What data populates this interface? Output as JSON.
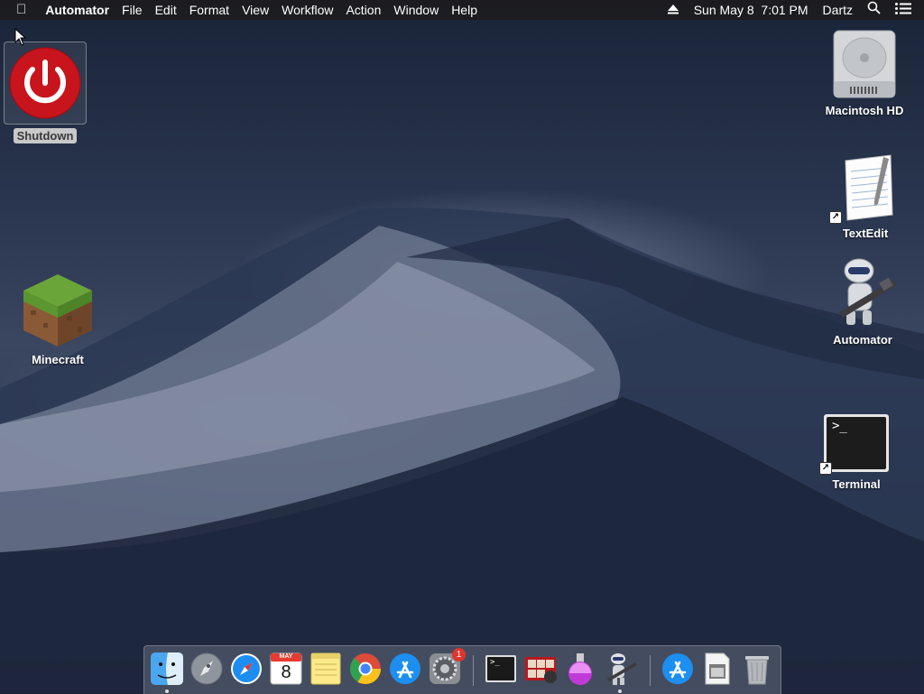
{
  "menubar": {
    "apple_glyph": "",
    "app_name": "Automator",
    "menus": [
      "File",
      "Edit",
      "Format",
      "View",
      "Workflow",
      "Action",
      "Window",
      "Help"
    ],
    "clock": "Sun May 8  7:01 PM",
    "user": "Dartz",
    "status_icons": [
      "eject-icon",
      "search-icon",
      "notification-list-icon"
    ]
  },
  "desktop": {
    "icons": [
      {
        "label": "Shutdown",
        "icon": "power-icon",
        "selected": true
      },
      {
        "label": "Minecraft",
        "icon": "grass-block-icon"
      },
      {
        "label": "Macintosh HD",
        "icon": "hard-drive-icon"
      },
      {
        "label": "TextEdit",
        "icon": "textedit-icon",
        "alias": true
      },
      {
        "label": "Automator",
        "icon": "automator-robot-icon"
      },
      {
        "label": "Terminal",
        "icon": "terminal-icon",
        "alias": true,
        "prompt": ">_"
      }
    ]
  },
  "dock": {
    "items": [
      {
        "name": "finder-icon",
        "running": true
      },
      {
        "name": "launchpad-icon"
      },
      {
        "name": "safari-icon"
      },
      {
        "name": "calendar-icon",
        "month": "MAY",
        "day": "8"
      },
      {
        "name": "notes-icon"
      },
      {
        "name": "chrome-icon"
      },
      {
        "name": "app-store-icon"
      },
      {
        "name": "system-preferences-icon",
        "badge": "1"
      },
      {
        "name": "terminal-icon",
        "prompt": ">_"
      },
      {
        "name": "photo-booth-icon"
      },
      {
        "name": "potion-app-icon"
      },
      {
        "name": "automator-icon",
        "running": true
      },
      {
        "name": "app-store-folder-icon"
      },
      {
        "name": "preview-icon"
      },
      {
        "name": "trash-icon"
      }
    ]
  },
  "colors": {
    "menubar_bg": "#1c1c1e",
    "power_red": "#c8141c",
    "badge_red": "#e0342c"
  }
}
